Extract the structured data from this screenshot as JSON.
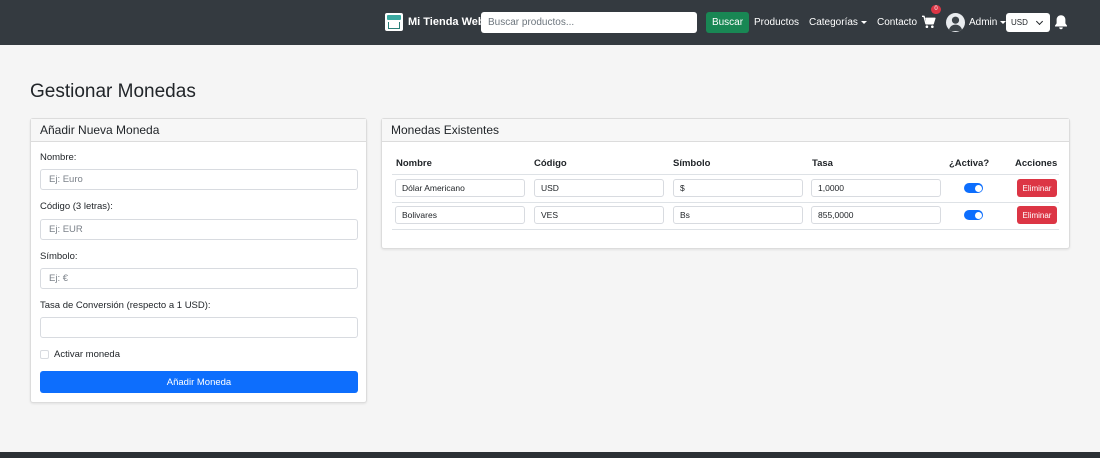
{
  "navbar": {
    "brand": "Mi Tienda Web",
    "search_placeholder": "Buscar productos...",
    "search_button": "Buscar",
    "links": {
      "productos": "Productos",
      "categorias": "Categorías",
      "contacto": "Contacto"
    },
    "cart_count": "0",
    "user": "Admin",
    "currency": "USD",
    "icons": [
      "store-logo-icon",
      "cart-icon",
      "avatar-icon",
      "bell-icon",
      "chevron-down-icon"
    ]
  },
  "page": {
    "title": "Gestionar Monedas"
  },
  "add_form": {
    "header": "Añadir Nueva Moneda",
    "name_label": "Nombre:",
    "name_placeholder": "Ej: Euro",
    "code_label": "Código (3 letras):",
    "code_placeholder": "Ej: EUR",
    "symbol_label": "Símbolo:",
    "symbol_placeholder": "Ej: €",
    "rate_label": "Tasa de Conversión (respecto a 1 USD):",
    "rate_placeholder": "",
    "activate_label": "Activar moneda",
    "submit": "Añadir Moneda"
  },
  "currency_list": {
    "header": "Monedas Existentes",
    "columns": [
      "Nombre",
      "Código",
      "Símbolo",
      "Tasa",
      "¿Activa?",
      "Acciones"
    ],
    "rows": [
      {
        "name": "Dólar Americano",
        "code": "USD",
        "symbol": "$",
        "rate": "1,0000",
        "active": true,
        "action": "Eliminar"
      },
      {
        "name": "Bolivares",
        "code": "VES",
        "symbol": "Bs",
        "rate": "855,0000",
        "active": true,
        "action": "Eliminar"
      }
    ]
  },
  "colors": {
    "navbar": "#343a40",
    "primary": "#0d6efd",
    "success": "#198754",
    "danger": "#dc3545"
  }
}
